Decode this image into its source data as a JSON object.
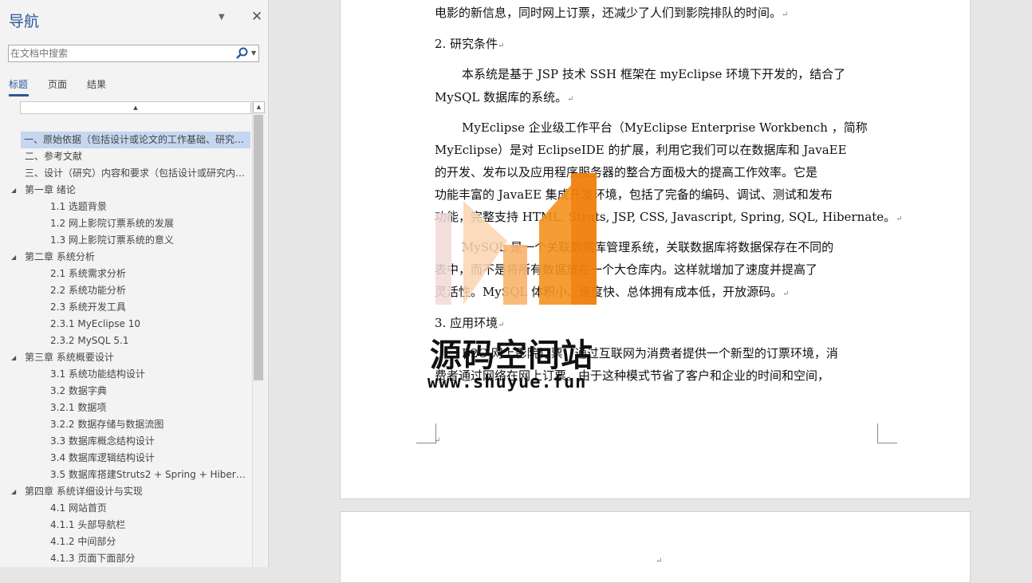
{
  "nav": {
    "title": "导航",
    "search_placeholder": "在文档中搜索",
    "tabs": {
      "headings": "标题",
      "pages": "页面",
      "results": "结果"
    },
    "tree": [
      {
        "label": "一、原始依据（包括设计或论文的工作基础、研究…",
        "level": 0,
        "selected": true
      },
      {
        "label": "二、参考文献",
        "level": 0
      },
      {
        "label": "三、设计（研究）内容和要求（包括设计或研究内…",
        "level": 0
      },
      {
        "label": "第一章        绪论",
        "level": 0,
        "expander": "◢"
      },
      {
        "label": "1.1     选题背景",
        "level": 2
      },
      {
        "label": "1.2     网上影院订票系统的发展",
        "level": 2
      },
      {
        "label": "1.3     网上影院订票系统的意义",
        "level": 2
      },
      {
        "label": "第二章        系统分析",
        "level": 0,
        "expander": "◢"
      },
      {
        "label": "2.1     系统需求分析",
        "level": 2
      },
      {
        "label": "2.2     系统功能分析",
        "level": 2
      },
      {
        "label": "2.3     系统开发工具",
        "level": 2
      },
      {
        "label": "2.3.1     MyEclipse 10",
        "level": 2
      },
      {
        "label": "2.3.2     MySQL 5.1",
        "level": 2
      },
      {
        "label": "第三章        系统概要设计",
        "level": 0,
        "expander": "◢"
      },
      {
        "label": "3.1     系统功能结构设计",
        "level": 2
      },
      {
        "label": "3.2     数据字典",
        "level": 2
      },
      {
        "label": "3.2.1     数据项",
        "level": 2
      },
      {
        "label": "3.2.2     数据存储与数据流图",
        "level": 2
      },
      {
        "label": "3.3     数据库概念结构设计",
        "level": 2
      },
      {
        "label": "3.4     数据库逻辑结构设计",
        "level": 2
      },
      {
        "label": "3.5     数据库搭建Struts2 + Spring + Hiber…",
        "level": 2
      },
      {
        "label": "第四章        系统详细设计与实现",
        "level": 0,
        "expander": "◢"
      },
      {
        "label": "4.1     网站首页",
        "level": 2
      },
      {
        "label": "4.1.1     头部导航栏",
        "level": 2
      },
      {
        "label": "4.1.2     中间部分",
        "level": 2
      },
      {
        "label": "4.1.3     页面下面部分",
        "level": 2
      }
    ]
  },
  "document": {
    "lines": [
      "电影的新信息，同时网上订票，还减少了人们到影院排队的时间。",
      "2.          研究条件",
      "本系统是基于 JSP 技术 SSH 框架在 myEclipse 环境下开发的，结合了",
      "MySQL 数据库的系统。",
      "MyEclipse 企业级工作平台（MyEclipse Enterprise Workbench ，简称",
      "MyEclipse）是对 EclipseIDE 的扩展，利用它我们可以在数据库和 JavaEE",
      "的开发、发布以及应用程序服务器的整合方面极大的提高工作效率。它是",
      "功能丰富的 JavaEE 集成开发环境，包括了完备的编码、调试、测试和发布",
      "功能，完整支持 HTML, Struts, JSP, CSS, Javascript, Spring, SQL, Hibernate。",
      "MySQL 是一个关联数据库管理系统，关联数据库将数据保存在不同的",
      "表中，而不是将所有数据放在一个大仓库内。这样就增加了速度并提高了",
      "灵活性。MySQL 体积小、速度快、总体拥有成本低，开放源码。",
      "3.          应用环境",
      "B2C 网上影院订票，通过互联网为消费者提供一个新型的订票环境，消",
      "费者通过网络在网上订票。由于这种模式节省了客户和企业的时间和空间，"
    ],
    "paragraph_mark": "↵"
  },
  "watermark": {
    "name": "源码空间站",
    "url": "www.shuyue.fun",
    "colors": [
      "#f2d9d9",
      "#fbd3b0",
      "#f8b46a",
      "#f5911e",
      "#f07f0a"
    ]
  }
}
